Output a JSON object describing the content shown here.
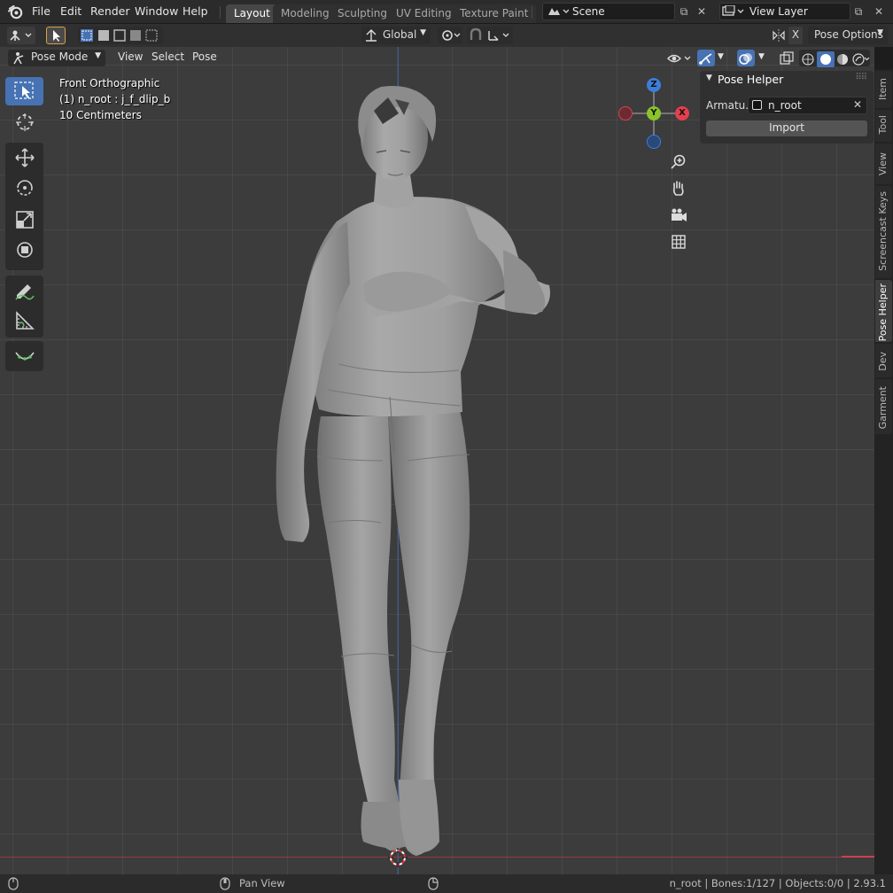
{
  "topbar": {
    "menu": [
      "File",
      "Edit",
      "Render",
      "Window",
      "Help"
    ],
    "workspaces": [
      "Layout",
      "Modeling",
      "Sculpting",
      "UV Editing",
      "Texture Paint"
    ],
    "active_workspace": "Layout",
    "scene": "Scene",
    "view_layer": "View Layer"
  },
  "header2": {
    "transform_orientation": "Global",
    "pose_options": "Pose Options",
    "x_mirror": "X"
  },
  "viewport_header": {
    "mode": "Pose Mode",
    "menus": [
      "View",
      "Select",
      "Pose"
    ]
  },
  "overlay": {
    "view_name": "Front Orthographic",
    "active_info": "(1) n_root : j_f_dlip_b",
    "scale": "10 Centimeters"
  },
  "gizmo": {
    "z": "Z",
    "y": "Y",
    "x": "X"
  },
  "pose_helper": {
    "title": "Pose Helper",
    "armature_label": "Armatu...",
    "armature_value": "n_root",
    "import_label": "Import"
  },
  "sidebar_tabs": [
    "Item",
    "Tool",
    "View",
    "Screencast Keys",
    "Pose Helper",
    "Dev",
    "Garment"
  ],
  "active_sidebar_tab": "Pose Helper",
  "statusbar": {
    "middle_hint": "Pan View",
    "stats": "n_root | Bones:1/127 | Objects:0/0 | 2.93.1"
  },
  "colors": {
    "accent": "#4772b3",
    "axis_x": "#e3404f",
    "axis_y": "#8ac32a",
    "axis_z": "#3d7ed9"
  }
}
